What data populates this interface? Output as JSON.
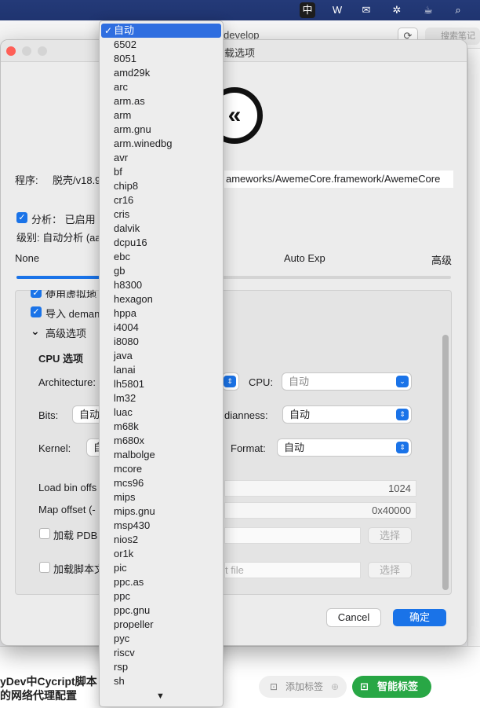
{
  "menubar": {
    "icons": [
      {
        "name": "input-method-icon",
        "glyph": "中"
      },
      {
        "name": "wps-icon",
        "glyph": "W"
      },
      {
        "name": "wechat-icon",
        "glyph": "✉"
      },
      {
        "name": "snowflake-icon",
        "glyph": "✲"
      },
      {
        "name": "cup-icon",
        "glyph": "☕"
      },
      {
        "name": "spotlight-icon",
        "glyph": "⌕"
      }
    ]
  },
  "background_app": {
    "title": "develop",
    "search_placeholder": "搜索笔记",
    "article_title_line1": "yDev中Cycript脚本",
    "article_title_line2": "的网络代理配置",
    "tag_add_label": "添加标签",
    "smart_tag_label": "智能标签"
  },
  "dialog": {
    "title": "载选项",
    "program_label": "程序:",
    "program_value_left": "脱壳/v18.9",
    "program_value_right": "ameworks/AwemeCore.framework/AwemeCore",
    "analysis_label": "分析：  已启用",
    "level_label": "级别: 自动分析 (aa",
    "slider": {
      "left_label": "None",
      "mid_label": "Auto Exp",
      "right_label": "高级",
      "level": 0.2
    },
    "options": {
      "use_vaddr_label": "使用虚拟地",
      "import_label": "导入 deman",
      "advanced_label": "高级选项"
    },
    "cpu_section": {
      "title": "CPU 选项",
      "architecture_label": "Architecture:",
      "cpu_label": "CPU:",
      "cpu_value": "自动",
      "bits_label": "Bits:",
      "bits_value": "自动",
      "endianness_label": "dianness:",
      "endianness_value": "自动",
      "kernel_label": "Kernel:",
      "kernel_value": "自",
      "format_label": "Format:",
      "format_value": "自动",
      "load_bin_label": "Load bin offs",
      "load_bin_value": "1024",
      "map_offset_label": "Map offset (-",
      "map_offset_value": "0x40000",
      "pdb_label": "加载 PDB",
      "pdb_button": "选择",
      "script_label": "加载脚本文",
      "script_placeholder": "t file",
      "script_button": "选择"
    },
    "cancel_label": "Cancel",
    "ok_label": "确定"
  },
  "dropdown": {
    "selected": "自动",
    "items": [
      "自动",
      "6502",
      "8051",
      "amd29k",
      "arc",
      "arm.as",
      "arm",
      "arm.gnu",
      "arm.winedbg",
      "avr",
      "bf",
      "chip8",
      "cr16",
      "cris",
      "dalvik",
      "dcpu16",
      "ebc",
      "gb",
      "h8300",
      "hexagon",
      "hppa",
      "i4004",
      "i8080",
      "java",
      "lanai",
      "lh5801",
      "lm32",
      "luac",
      "m68k",
      "m680x",
      "malbolge",
      "mcore",
      "mcs96",
      "mips",
      "mips.gnu",
      "msp430",
      "nios2",
      "or1k",
      "pic",
      "ppc.as",
      "ppc",
      "ppc.gnu",
      "propeller",
      "pyc",
      "riscv",
      "rsp",
      "sh"
    ]
  },
  "colors": {
    "accent": "#1a73e8",
    "selection": "#2f6ee0",
    "smart_tag": "#28a745",
    "menubar": "#243a78"
  }
}
